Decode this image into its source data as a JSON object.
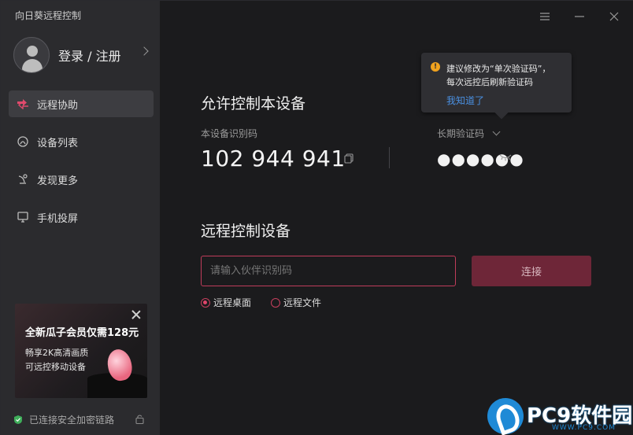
{
  "app": {
    "title": "向日葵远程控制"
  },
  "user": {
    "login_label": "登录 / 注册"
  },
  "sidebar": {
    "items": [
      {
        "label": "远程协助",
        "icon": "remote-assist-icon",
        "active": true
      },
      {
        "label": "设备列表",
        "icon": "device-list-icon",
        "active": false
      },
      {
        "label": "发现更多",
        "icon": "discover-icon",
        "active": false
      },
      {
        "label": "手机投屏",
        "icon": "screen-cast-icon",
        "active": false
      }
    ]
  },
  "promo": {
    "title": "全新瓜子会员仅需128元",
    "line1": "畅享2K高清画质",
    "line2": "可远控移动设备"
  },
  "status": {
    "text": "已连接安全加密链路"
  },
  "allow_control": {
    "title": "允许控制本设备",
    "id_label": "本设备识别码",
    "device_id": "102 944 941",
    "code_label": "长期验证码",
    "code_masked": "●●●●●●"
  },
  "tooltip": {
    "line1": "建议修改为“单次验证码”，",
    "line2": "每次远控后刷新验证码",
    "link": "我知道了"
  },
  "remote_control": {
    "title": "远程控制设备",
    "input_placeholder": "请输入伙伴识别码",
    "input_value": "",
    "connect_label": "连接",
    "options": [
      {
        "label": "远程桌面",
        "selected": true
      },
      {
        "label": "远程文件",
        "selected": false
      }
    ]
  },
  "watermark": {
    "text": "PC9软件园",
    "sub": "WWW.PC9.COM"
  },
  "colors": {
    "accent": "#c03c5a",
    "connect_bg": "#6e2638",
    "link": "#4a90e2",
    "warning": "#f0a21e"
  }
}
